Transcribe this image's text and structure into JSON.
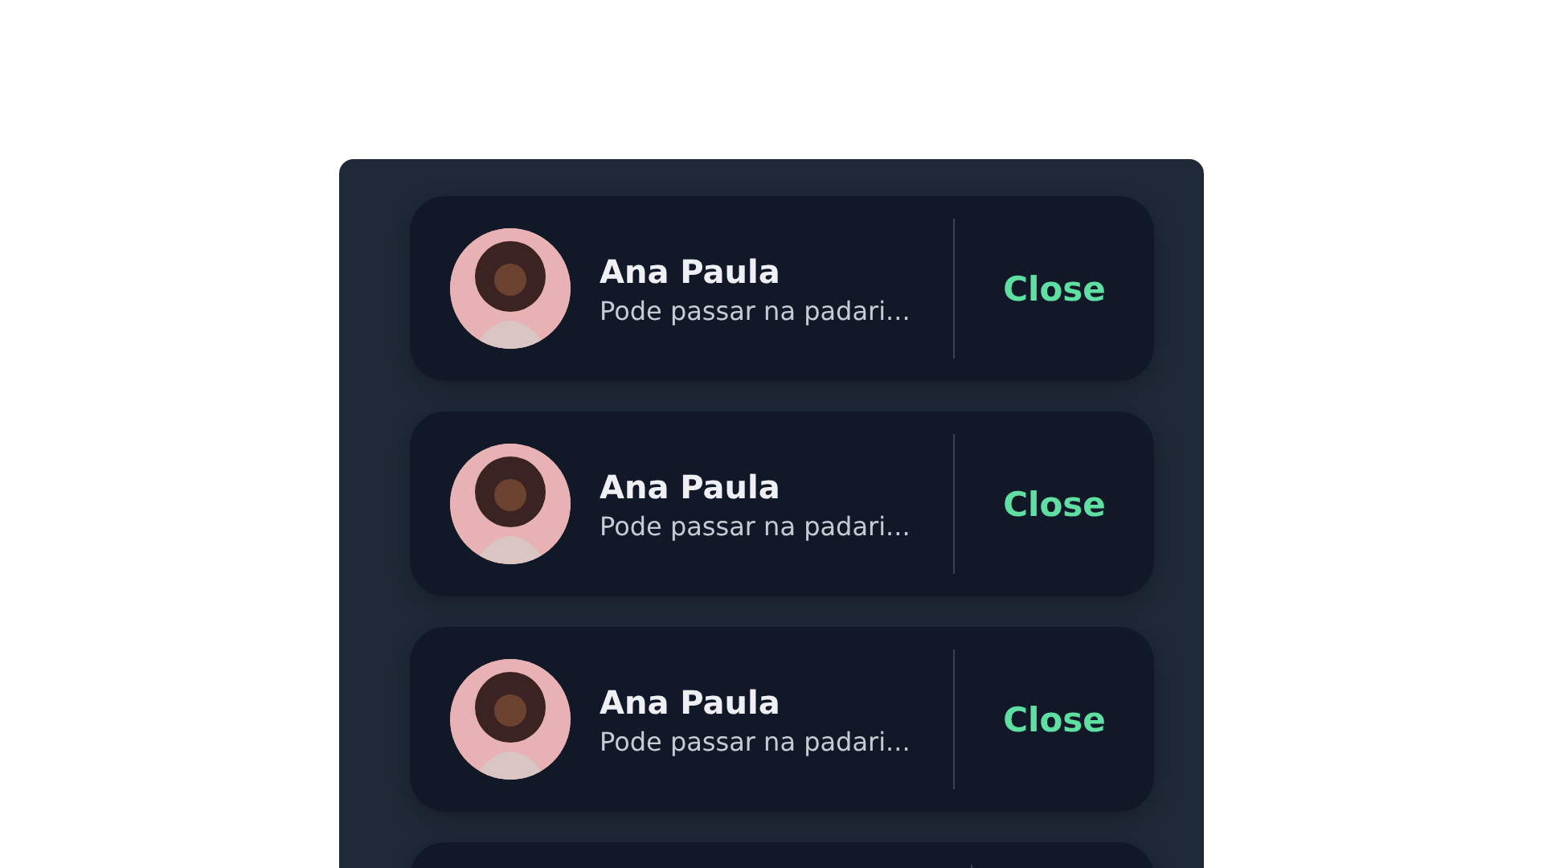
{
  "notifications": [
    {
      "name": "Ana Paula",
      "message": "Pode passar na padari...",
      "action": "Close"
    },
    {
      "name": "Ana Paula",
      "message": "Pode passar na padari...",
      "action": "Close"
    },
    {
      "name": "Ana Paula",
      "message": "Pode passar na padari...",
      "action": "Close"
    }
  ]
}
